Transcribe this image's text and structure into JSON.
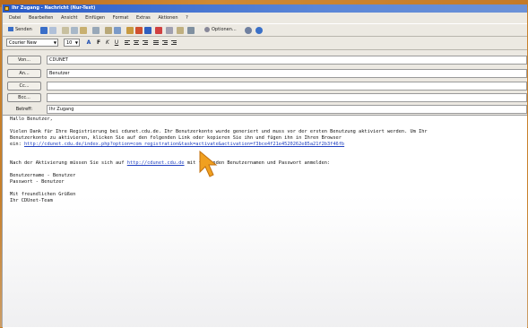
{
  "window": {
    "title": "Ihr Zugang - Nachricht (Nur-Text)"
  },
  "menu": [
    "Datei",
    "Bearbeiten",
    "Ansicht",
    "Einfügen",
    "Format",
    "Extras",
    "Aktionen",
    "?"
  ],
  "toolbar": {
    "send_label": "Senden",
    "options_label": "Optionen..."
  },
  "format": {
    "font": "Courier New",
    "size": "10"
  },
  "header": {
    "to_label": "An...",
    "to_value": "Benutzer",
    "from_label": "Von...",
    "from_value": "CDUNET",
    "cc_label": "Cc...",
    "cc_value": "",
    "bcc_label": "Bcc...",
    "bcc_value": "",
    "subject_label": "Betreff:",
    "subject_value": "Ihr Zugang"
  },
  "body": {
    "greeting": "Hallo Benutzer,",
    "p1_line1": "Vielen Dank für Ihre Registrierung bei cdunet.cdu.de. Ihr Benutzerkonto wurde generiert und muss vor der ersten Benutzung aktiviert werden. Um Ihr",
    "p1_line2": "Benutzerkonto zu aktivieren, klicken Sie auf den folgenden Link oder kopieren Sie ihn und fügen ihn in Ihren Browser",
    "p1_line3_prefix": "ein: ",
    "activation_link": "http://cdunet.cdu.de/index.php?option=com_registration&task=activate&activation=f3bce4f21e4520262e85a21f2b3f46fb",
    "p2_prefix": "Nach der Aktivierung müssen Sie sich auf ",
    "login_link": "http://cdunet.cdu.de",
    "p2_suffix": " mit folgenden Benutzernamen und Passwort anmelden:",
    "username_line": "Benutzername - Benutzer",
    "password_line": "Passwort - Benutzer",
    "closing1": "Mit freundlichen Grüßen",
    "closing2": "Ihr CDUnet-Team"
  },
  "colors": {
    "link": "#2040c0",
    "cursor": "#f0a020",
    "titlebar": "#2a5bc8"
  }
}
